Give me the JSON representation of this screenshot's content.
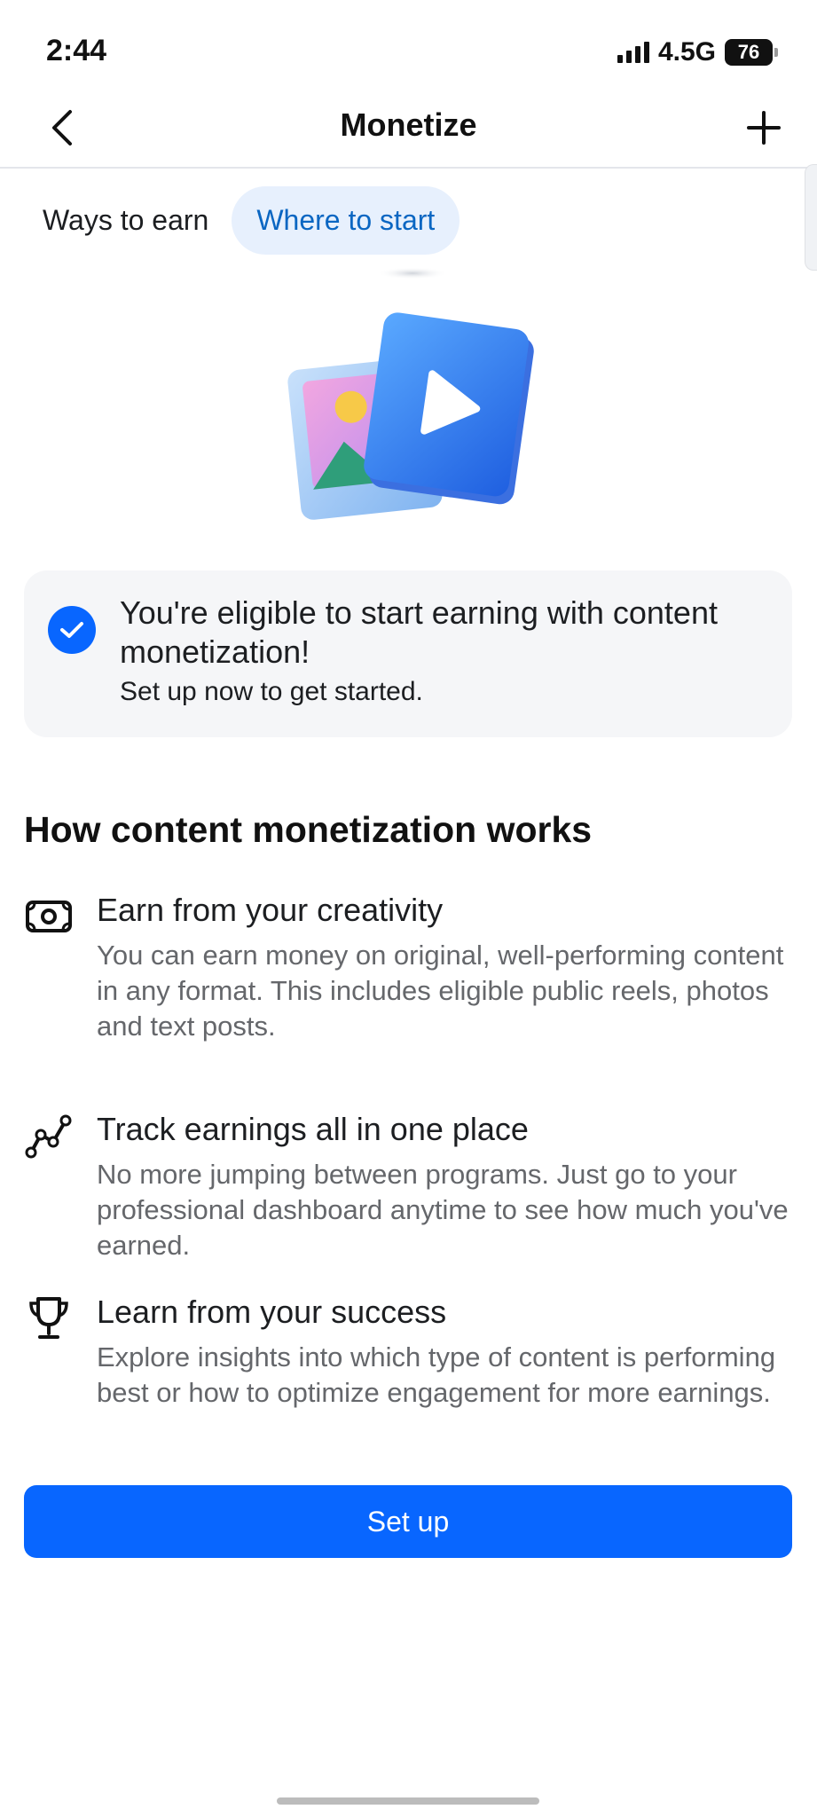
{
  "status_bar": {
    "time": "2:44",
    "network": "4.5G",
    "battery": "76"
  },
  "header": {
    "title": "Monetize",
    "back_icon": "chevron-left-icon",
    "add_icon": "plus-icon"
  },
  "tabs": [
    {
      "label": "Ways to earn",
      "active": false
    },
    {
      "label": "Where to start",
      "active": true
    }
  ],
  "hero": {
    "icon": "media-monetization-illustration"
  },
  "eligibility": {
    "icon": "check-circle-icon",
    "title": "You're eligible to start earning with content monetization!",
    "subtitle": "Set up now to get started."
  },
  "section": {
    "title": "How content monetization works",
    "items": [
      {
        "icon": "money-icon",
        "title": "Earn from your creativity",
        "description": "You can earn money on original, well-performing content in any format. This includes eligible public reels, photos and text posts."
      },
      {
        "icon": "trend-line-icon",
        "title": "Track earnings all in one place",
        "description": "No more jumping between programs. Just go to your professional dashboard anytime to see how much you've earned."
      },
      {
        "icon": "trophy-icon",
        "title": "Learn from your success",
        "description": "Explore insights into which type of content is performing best or how to optimize engagement for more earnings."
      }
    ]
  },
  "primary_button": {
    "label": "Set up"
  },
  "colors": {
    "accent": "#0866ff",
    "tab_active_bg": "#e7f0fd",
    "tab_active_text": "#0a66c2",
    "secondary_text": "#65676b"
  }
}
